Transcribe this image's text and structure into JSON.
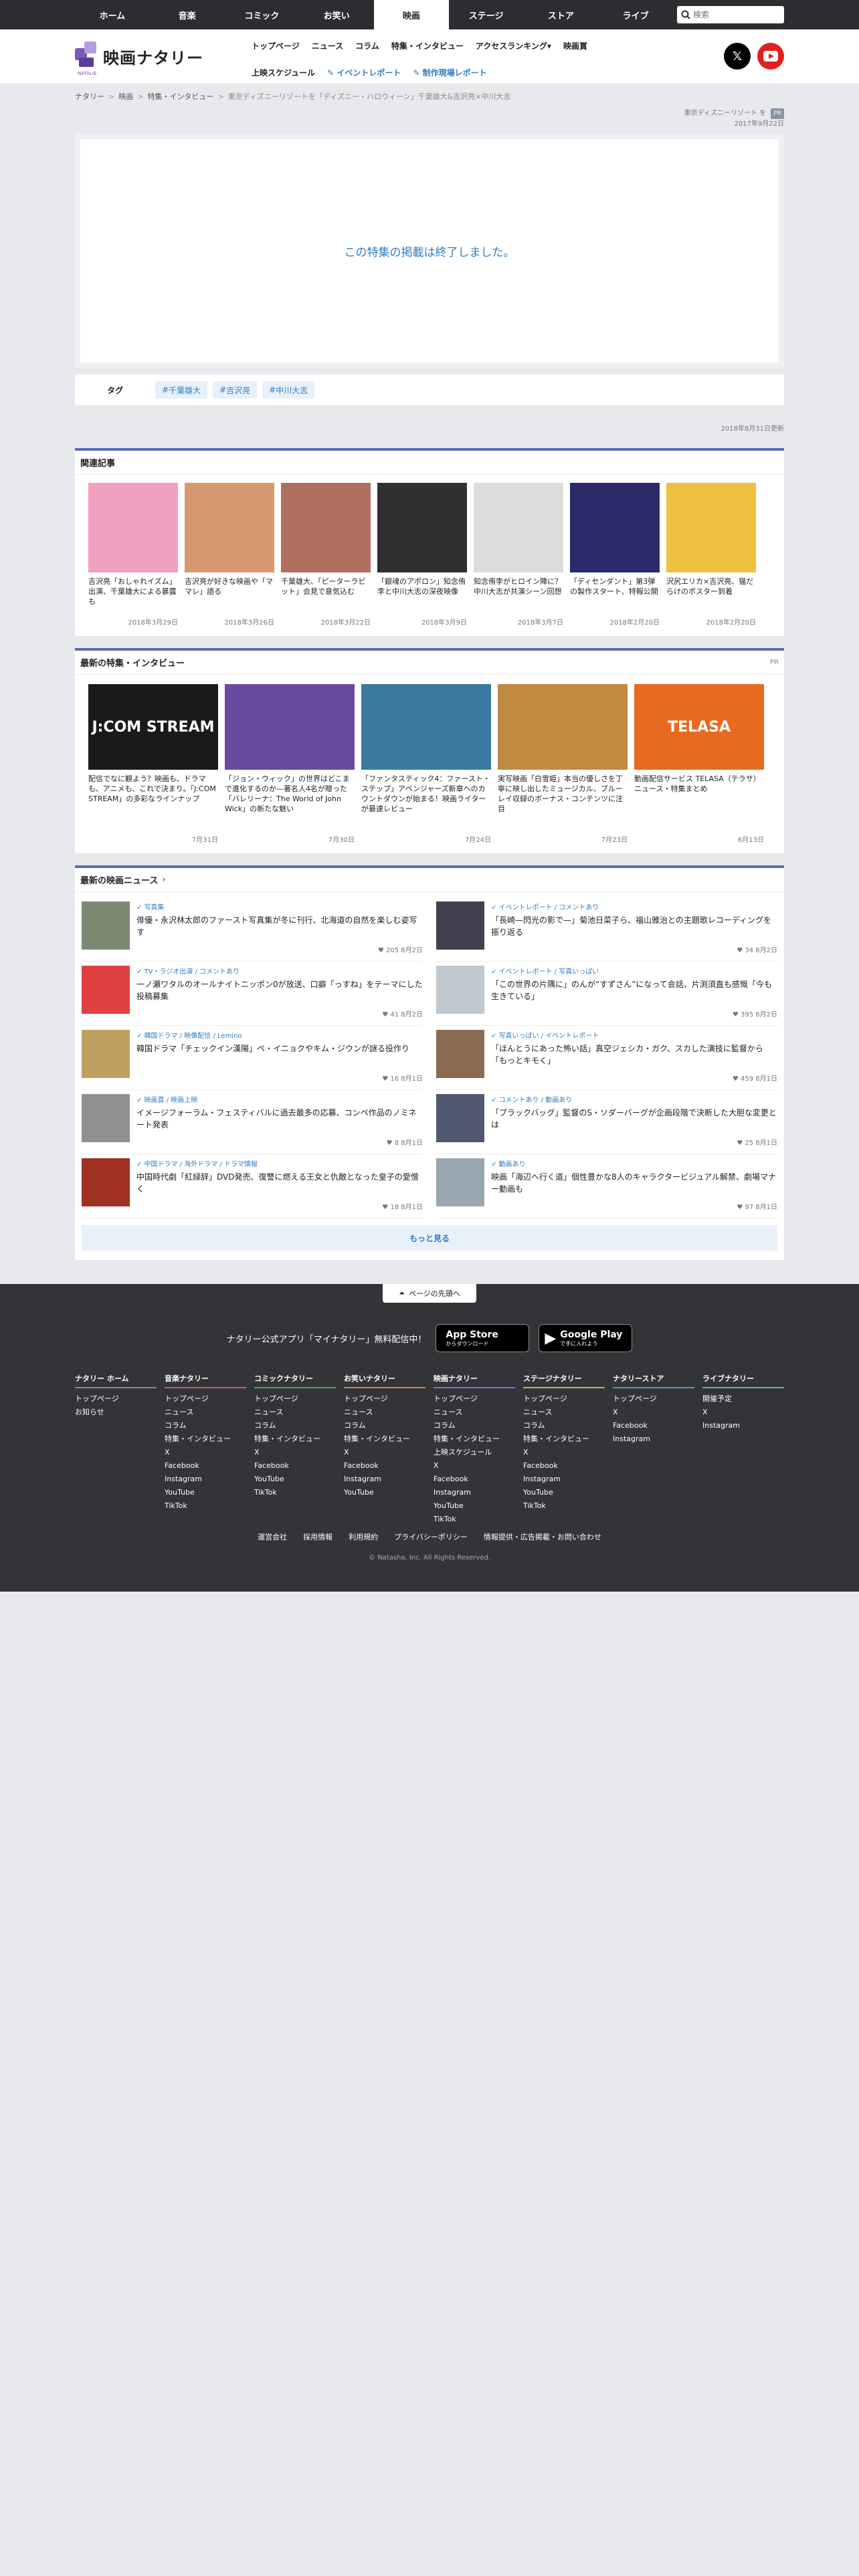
{
  "topnav": {
    "tabs": [
      "ホーム",
      "音楽",
      "コミック",
      "お笑い",
      "映画",
      "ステージ",
      "ストア",
      "ライブ"
    ],
    "active_index": 4,
    "search_placeholder": "検索"
  },
  "header": {
    "logo_text": "映画ナタリー",
    "logo_sub": "NATALIE",
    "nav_row1": [
      "トップページ",
      "ニュース",
      "コラム",
      "特集・インタビュー",
      "アクセスランキング▾",
      "映画賞"
    ],
    "nav_row2": [
      "上映スケジュール",
      "イベントレポート",
      "制作現場レポート"
    ]
  },
  "breadcrumb": [
    "ナタリー",
    "映画",
    "特集・インタビュー",
    "東京ディズニーリゾートを「ディズニー・ハロウィーン」千葉雄大&吉沢亮×中川大志"
  ],
  "meta": {
    "series": "東京ディズニーリゾート",
    "pr": "PR",
    "date": "2017年9月22日"
  },
  "ended_message": "この特集の掲載は終了しました。",
  "tags": {
    "label": "タグ",
    "items": [
      "千葉雄大",
      "吉沢亮",
      "中川大志"
    ]
  },
  "updated": "2018年8月31日更新",
  "related": {
    "heading": "関連記事",
    "items": [
      {
        "title": "吉沢亮「おしゃれイズム」出演、千葉雄大による暴露も",
        "date": "2018年3月29日",
        "color": "#f0a0c0"
      },
      {
        "title": "吉沢亮が好きな映画や「ママレ」語る",
        "date": "2018年3月26日",
        "color": "#d89870"
      },
      {
        "title": "千葉雄大、「ピーターラビット」会見で意気込む",
        "date": "2018年3月22日",
        "color": "#b07060"
      },
      {
        "title": "「銀魂のアポロン」知念侑李と中川大志の深夜映像",
        "date": "2018年3月9日",
        "color": "#303030"
      },
      {
        "title": "知念侑李がヒロイン陣に？中川大志が共演シーン回想",
        "date": "2018年3月7日",
        "color": "#dcdcdc"
      },
      {
        "title": "「ディセンダント」第3弾の製作スタート、特報公開",
        "date": "2018年2月20日",
        "color": "#2a2a6a"
      },
      {
        "title": "沢尻エリカ×吉沢亮、猫だらけのポスター到着",
        "date": "2018年2月20日",
        "color": "#f0c040"
      }
    ]
  },
  "features": {
    "heading": "最新の特集・インタビュー",
    "pr": "PR",
    "items": [
      {
        "title": "配信でなに観よう？映画も、ドラマも、アニメも、これで決まり。「J:COM STREAM」の多彩なラインナップ",
        "date": "7月31日",
        "color": "#1a1a1a",
        "logo": "J:COM STREAM"
      },
      {
        "title": "「ジョン・ウィック」の世界はどこまで進化するのか—著名人4名が贈った「バレリーナ：The World of John Wick」の新たな魅い",
        "date": "7月30日",
        "color": "#6a4aa0",
        "logo": ""
      },
      {
        "title": "「ファンタスティック4：ファースト・ステップ」アベンジャーズ新章へのカウントダウンが始まる！映画ライターが最速レビュー",
        "date": "7月24日",
        "color": "#3a7aa0",
        "logo": ""
      },
      {
        "title": "実写映画「白雪姫」本当の優しさを丁寧に映し出したミュージカル、ブルーレイ収録のボーナス・コンテンツに注目",
        "date": "7月23日",
        "color": "#c08a40",
        "logo": ""
      },
      {
        "title": "動画配信サービス TELASA（テラサ）ニュース・特集まとめ",
        "date": "6月13日",
        "color": "#e86a20",
        "logo": "TELASA"
      }
    ]
  },
  "news": {
    "heading": "最新の映画ニュース",
    "more_label": "もっと見る",
    "items": [
      {
        "cat": "写真集",
        "title": "俳優・永沢林太郎のファースト写真集が冬に刊行、北海道の自然を楽しむ姿写す",
        "count": "205",
        "date": "8月2日",
        "color": "#7a8a70"
      },
      {
        "cat": "イベントレポート / コメントあり",
        "title": "「長崎—閃光の影で—」菊池日菜子ら、福山雅治との主題歌レコーディングを振り返る",
        "count": "34",
        "date": "8月2日",
        "color": "#404050"
      },
      {
        "cat": "TV・ラジオ出演 / コメントあり",
        "title": "一ノ瀬ワタルのオールナイトニッポン0が放送、口癖「っすね」をテーマにした投稿募集",
        "count": "41",
        "date": "8月2日",
        "color": "#e04040"
      },
      {
        "cat": "イベントレポート / 写真いっぱい",
        "title": "「この世界の片隅に」のんが“すずさん”になって会話、片渕須直も感慨「今も生きている」",
        "count": "395",
        "date": "8月2日",
        "color": "#c0c8d0"
      },
      {
        "cat": "韓国ドラマ / 映像配信 / Lemino",
        "title": "韓国ドラマ「チェックイン漢陽」ペ・イニョクやキム・ジウンが謎る役作り",
        "count": "16",
        "date": "8月1日",
        "color": "#c0a060"
      },
      {
        "cat": "写真いっぱい / イベントレポート",
        "title": "「ほんとうにあった怖い話」真空ジェシカ・ガク、スカした演技に監督から「もっとキモく」",
        "count": "459",
        "date": "8月1日",
        "color": "#8a6a50"
      },
      {
        "cat": "映画賞 / 映画上映",
        "title": "イメージフォーラム・フェスティバルに過去最多の応募、コンペ作品のノミネート発表",
        "count": "8",
        "date": "8月1日",
        "color": "#909090"
      },
      {
        "cat": "コメントあり / 動画あり",
        "title": "「ブラックバッグ」監督のS・ソダーバーグが企画段階で決断した大胆な変更とは",
        "count": "25",
        "date": "8月1日",
        "color": "#505870"
      },
      {
        "cat": "中国ドラマ / 海外ドラマ / ドラマ情報",
        "title": "中国時代劇「紅緑辞」DVD発売、復讐に燃える王女と仇敵となった皇子の愛憎く",
        "count": "18",
        "date": "8月1日",
        "color": "#a03020"
      },
      {
        "cat": "動画あり",
        "title": "映画「海辺へ行く道」個性豊かな8人のキャラクタービジュアル解禁、劇場マナー動画も",
        "count": "97",
        "date": "8月1日",
        "color": "#98a8b0"
      }
    ]
  },
  "footer": {
    "to_top": "ページの先頭へ",
    "app_text": "ナタリー公式アプリ「マイナタリー」無料配信中！",
    "appstore_l1": "App Store",
    "appstore_l2": "からダウンロード",
    "gplay_l1": "Google Play",
    "gplay_l2": "で手に入れよう",
    "columns": [
      {
        "h": "ナタリー ホーム",
        "color": "#888888",
        "items": [
          "トップページ",
          "お知らせ"
        ]
      },
      {
        "h": "音楽ナタリー",
        "color": "#e05070",
        "items": [
          "トップページ",
          "ニュース",
          "コラム",
          "特集・インタビュー",
          "X",
          "Facebook",
          "Instagram",
          "YouTube",
          "TikTok"
        ]
      },
      {
        "h": "コミックナタリー",
        "color": "#40b060",
        "items": [
          "トップページ",
          "ニュース",
          "コラム",
          "特集・インタビュー",
          "X",
          "Facebook",
          "YouTube",
          "TikTok"
        ]
      },
      {
        "h": "お笑いナタリー",
        "color": "#e08030",
        "items": [
          "トップページ",
          "ニュース",
          "コラム",
          "特集・インタビュー",
          "X",
          "Facebook",
          "Instagram",
          "YouTube"
        ]
      },
      {
        "h": "映画ナタリー",
        "color": "#8a6ad0",
        "items": [
          "トップページ",
          "ニュース",
          "コラム",
          "特集・インタビュー",
          "上映スケジュール",
          "X",
          "Facebook",
          "Instagram",
          "YouTube",
          "TikTok"
        ]
      },
      {
        "h": "ステージナタリー",
        "color": "#d0b040",
        "items": [
          "トップページ",
          "ニュース",
          "コラム",
          "特集・インタビュー",
          "X",
          "Facebook",
          "Instagram",
          "YouTube",
          "TikTok"
        ]
      },
      {
        "h": "ナタリーストア",
        "color": "#40a0c0",
        "items": [
          "トップページ",
          "X",
          "Facebook",
          "Instagram"
        ]
      },
      {
        "h": "ライブナタリー",
        "color": "#50c0b0",
        "items": [
          "開催予定",
          "X",
          "Instagram"
        ]
      }
    ],
    "bottom_links": [
      "運営会社",
      "採用情報",
      "利用規約",
      "プライバシーポリシー",
      "情報提供・広告掲載・お問い合わせ"
    ],
    "copyright": "© Natasha, Inc. All Rights Reserved."
  }
}
